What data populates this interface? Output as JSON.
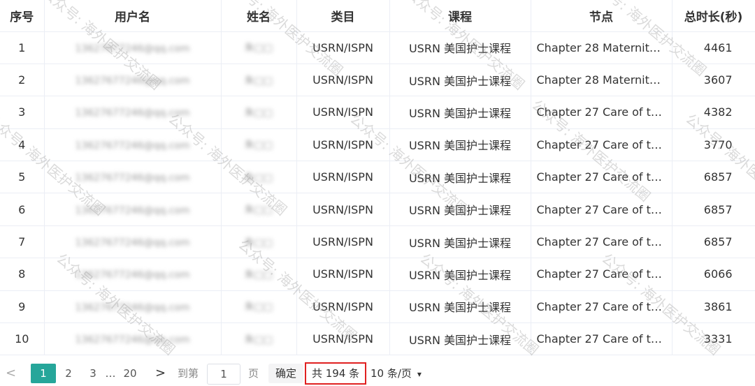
{
  "headers": [
    "序号",
    "用户名",
    "姓名",
    "类目",
    "课程",
    "节点",
    "总时长(秒)"
  ],
  "rows": [
    {
      "idx": "1",
      "user": "13627677246@qq.com",
      "name": "朱□□",
      "cat": "USRN/ISPN",
      "course": "USRN 美国护士课程",
      "node": "Chapter 28 Maternity ...",
      "dur": "4461"
    },
    {
      "idx": "2",
      "user": "13627677246@qq.com",
      "name": "朱□□",
      "cat": "USRN/ISPN",
      "course": "USRN 美国护士课程",
      "node": "Chapter 28 Maternity ...",
      "dur": "3607"
    },
    {
      "idx": "3",
      "user": "13627677246@qq.com",
      "name": "朱□□",
      "cat": "USRN/ISPN",
      "course": "USRN 美国护士课程",
      "node": "Chapter 27 Care of th...",
      "dur": "4382"
    },
    {
      "idx": "4",
      "user": "13627677246@qq.com",
      "name": "朱□□",
      "cat": "USRN/ISPN",
      "course": "USRN 美国护士课程",
      "node": "Chapter 27 Care of th...",
      "dur": "3770"
    },
    {
      "idx": "5",
      "user": "13627677246@qq.com",
      "name": "朱□□",
      "cat": "USRN/ISPN",
      "course": "USRN 美国护士课程",
      "node": "Chapter 27 Care of th...",
      "dur": "6857"
    },
    {
      "idx": "6",
      "user": "13627677246@qq.com",
      "name": "朱□□",
      "cat": "USRN/ISPN",
      "course": "USRN 美国护士课程",
      "node": "Chapter 27 Care of th...",
      "dur": "6857"
    },
    {
      "idx": "7",
      "user": "13627677246@qq.com",
      "name": "朱□□",
      "cat": "USRN/ISPN",
      "course": "USRN 美国护士课程",
      "node": "Chapter 27 Care of th...",
      "dur": "6857"
    },
    {
      "idx": "8",
      "user": "13627677246@qq.com",
      "name": "朱□□",
      "cat": "USRN/ISPN",
      "course": "USRN 美国护士课程",
      "node": "Chapter 27 Care of th...",
      "dur": "6066"
    },
    {
      "idx": "9",
      "user": "13627677246@qq.com",
      "name": "朱□□",
      "cat": "USRN/ISPN",
      "course": "USRN 美国护士课程",
      "node": "Chapter 27 Care of th...",
      "dur": "3861"
    },
    {
      "idx": "10",
      "user": "13627677246@qq.com",
      "name": "朱□□",
      "cat": "USRN/ISPN",
      "course": "USRN 美国护士课程",
      "node": "Chapter 27 Care of th...",
      "dur": "3331"
    }
  ],
  "pager": {
    "prev": "<",
    "pages": [
      "1",
      "2",
      "3",
      "…",
      "20"
    ],
    "next": ">",
    "goto_label": "到第",
    "goto_value": "1",
    "page_unit": "页",
    "confirm": "确定",
    "total": "共 194 条",
    "page_size": "10 条/页",
    "chevron": "▾"
  },
  "watermark_text": "公众号: 海外医护交流圈",
  "colors": {
    "accent": "#26a69a",
    "highlight_border": "#e02020"
  }
}
